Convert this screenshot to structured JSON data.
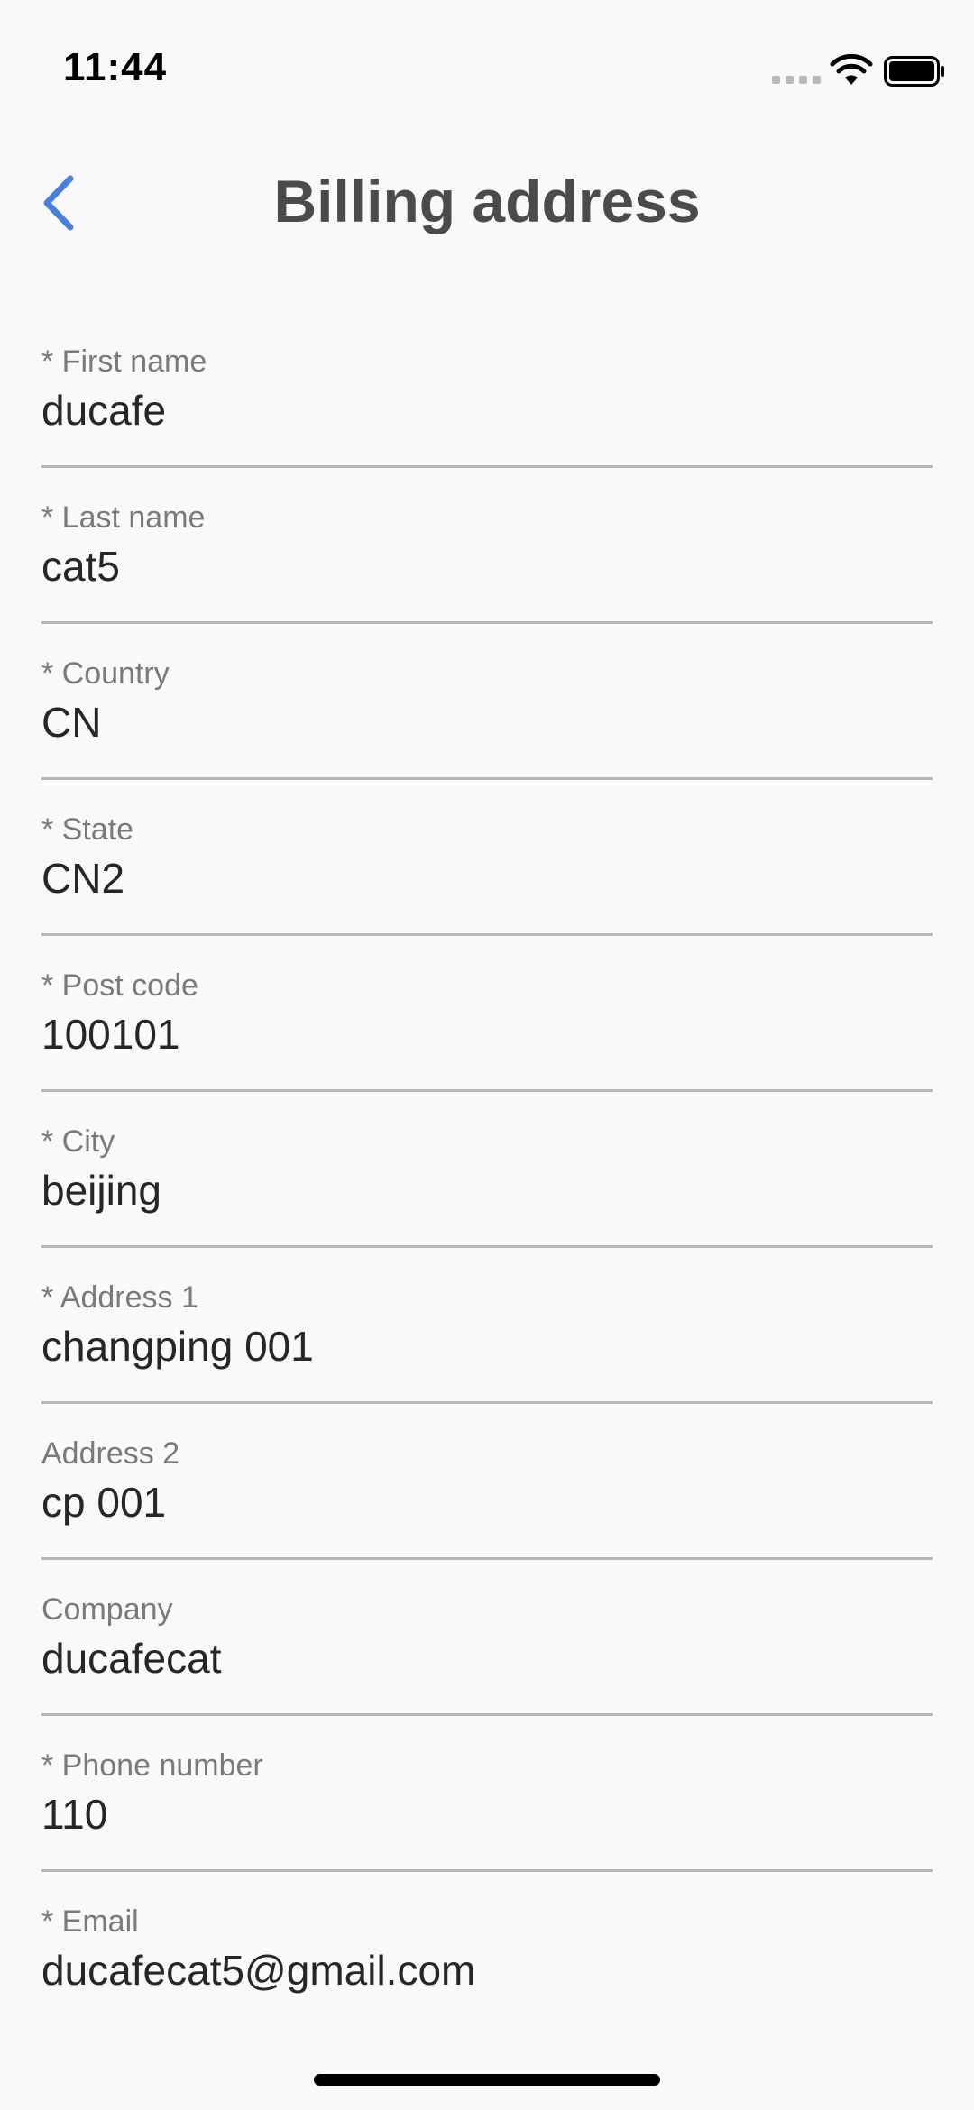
{
  "status_bar": {
    "time": "11:44"
  },
  "header": {
    "title": "Billing address"
  },
  "fields": [
    {
      "label": "* First name",
      "value": "ducafe"
    },
    {
      "label": "* Last name",
      "value": "cat5"
    },
    {
      "label": "* Country",
      "value": "CN"
    },
    {
      "label": "* State",
      "value": "CN2"
    },
    {
      "label": "* Post code",
      "value": "100101"
    },
    {
      "label": "* City",
      "value": "beijing"
    },
    {
      "label": "* Address 1",
      "value": "changping 001"
    },
    {
      "label": "Address 2",
      "value": "cp 001"
    },
    {
      "label": "Company",
      "value": "ducafecat"
    },
    {
      "label": "* Phone number",
      "value": "110"
    },
    {
      "label": "* Email",
      "value": "ducafecat5@gmail.com"
    }
  ],
  "colors": {
    "accent": "#4a7ee0",
    "title": "#4b4b4b",
    "divider": "#b7b7b7"
  },
  "icons": {
    "back": "chevron-left-icon",
    "wifi": "wifi-icon",
    "battery": "battery-icon",
    "signal": "signal-icon"
  }
}
